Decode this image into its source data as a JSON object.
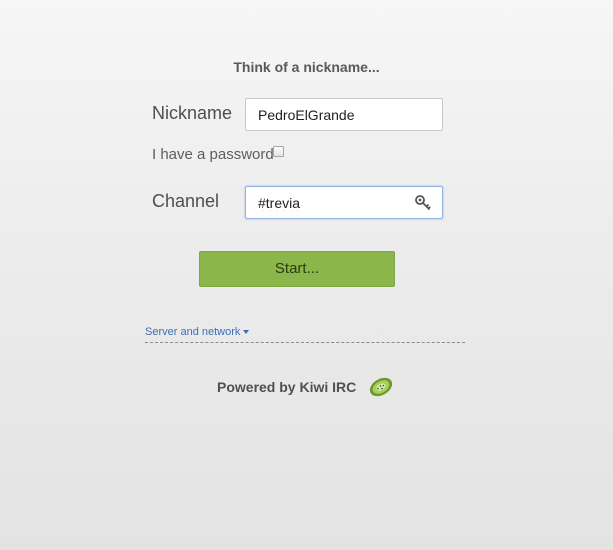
{
  "form": {
    "heading": "Think of a nickname...",
    "nickname_label": "Nickname",
    "nickname_value": "PedroElGrande",
    "password_label": "I have a password",
    "password_checked": false,
    "channel_label": "Channel",
    "channel_value": "#trevia",
    "channel_key_icon": "key-icon",
    "start_label": "Start..."
  },
  "server": {
    "toggle_label": "Server and network",
    "toggle_icon": "caret-down-icon"
  },
  "footer": {
    "powered_by": "Powered by Kiwi IRC",
    "logo_icon": "kiwi-logo-icon"
  },
  "colors": {
    "accent_green": "#8ab64a",
    "link_blue": "#3d6fb8",
    "focus_border": "#8fb0e0"
  }
}
